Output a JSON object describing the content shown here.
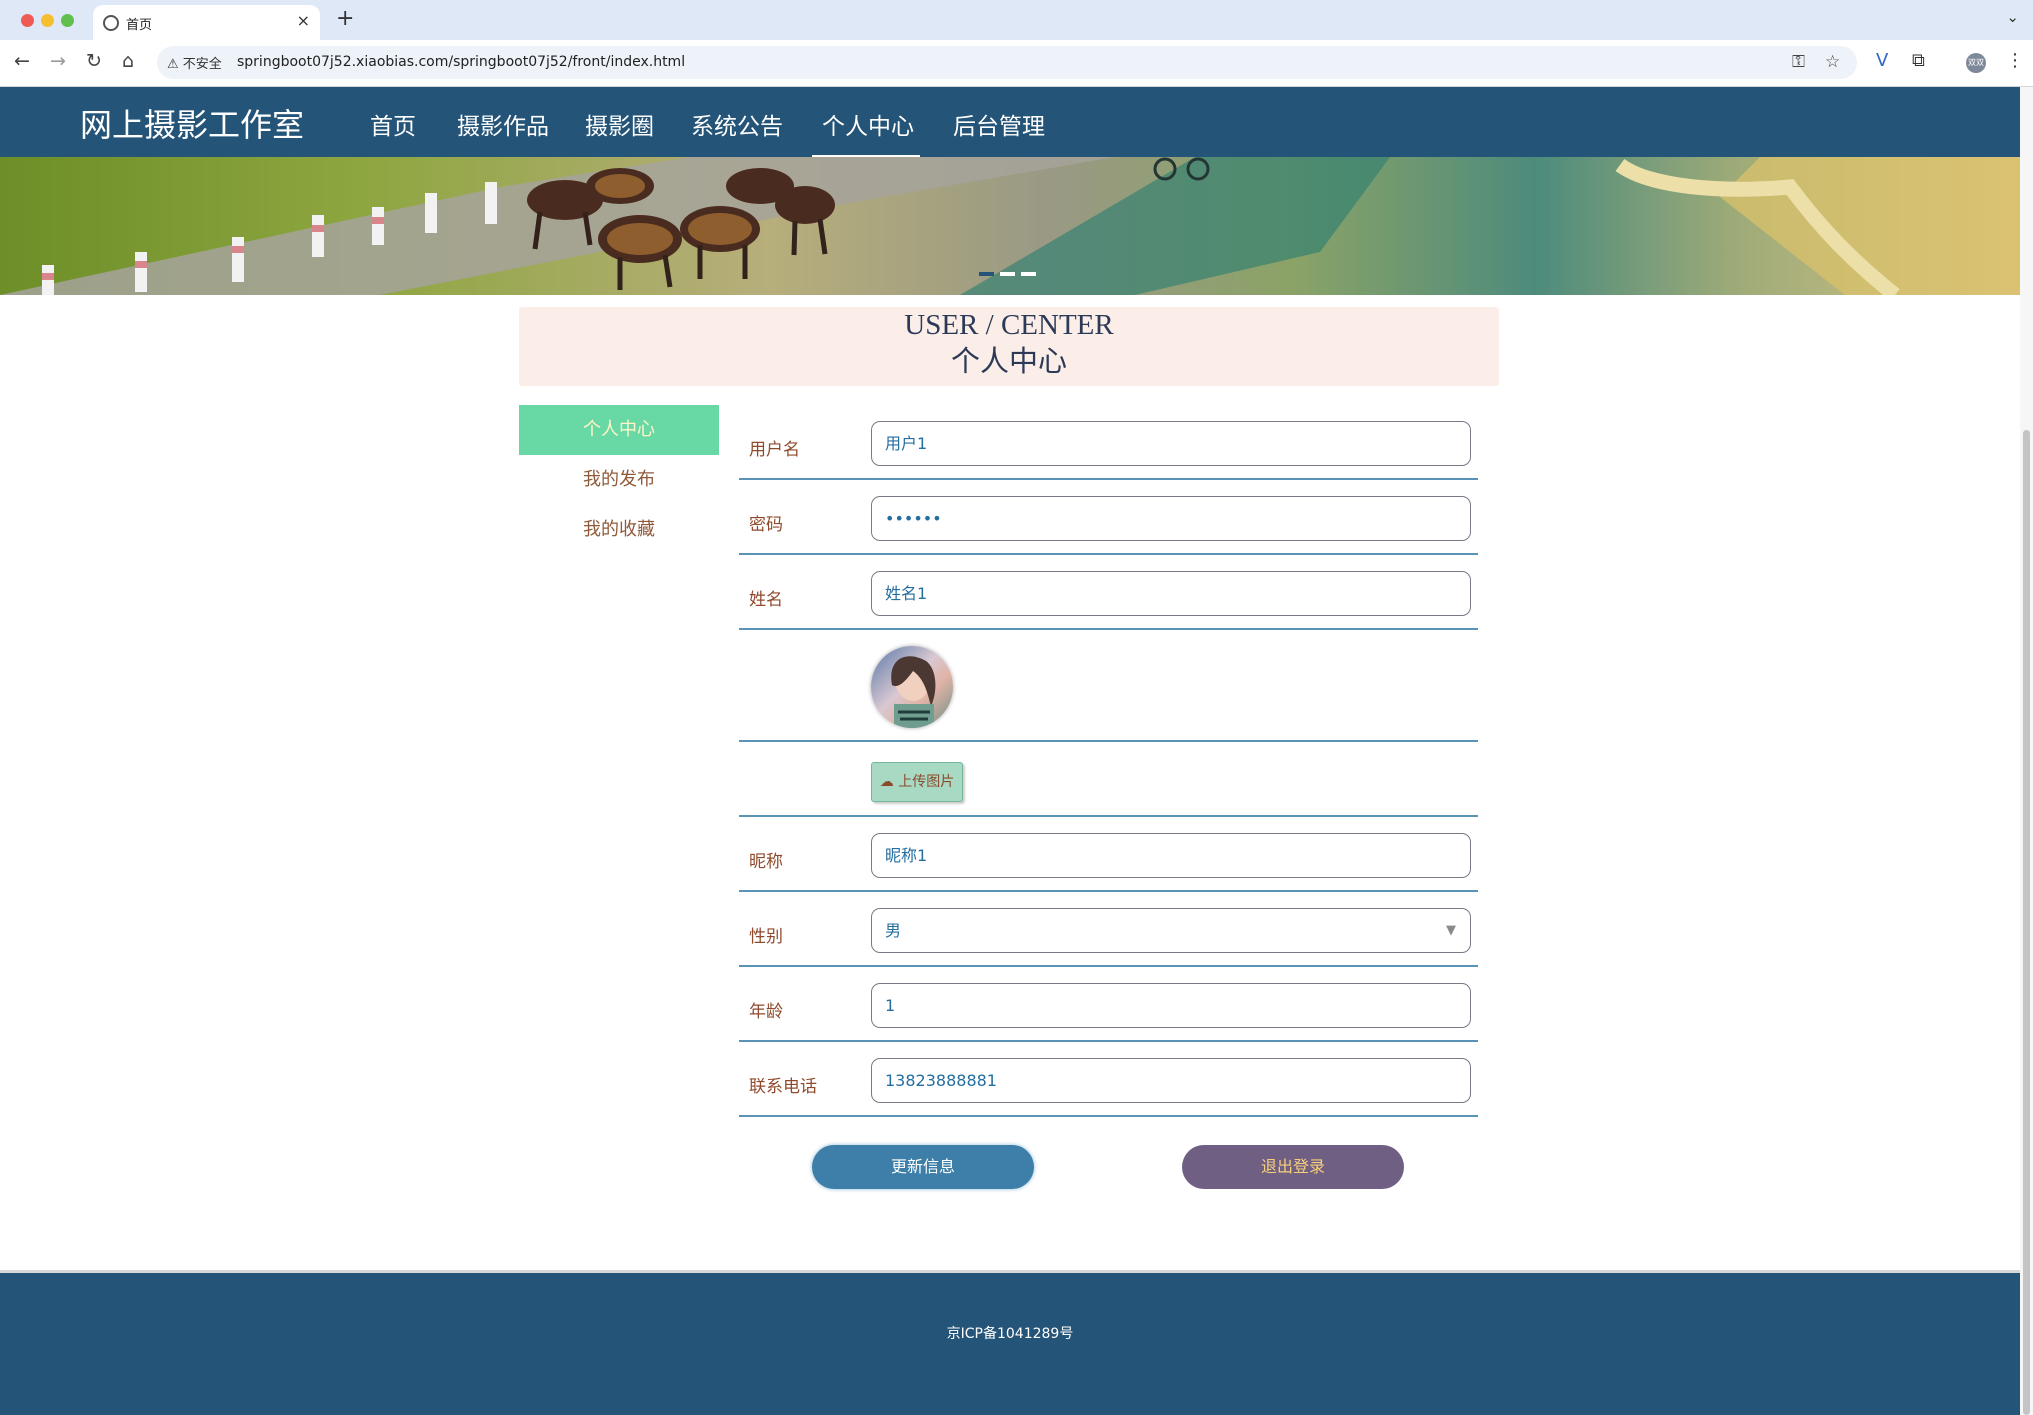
{
  "browser": {
    "tab_title": "首页",
    "url_warning": "不安全",
    "url": "springboot07j52.xiaobias.com/springboot07j52/front/index.html",
    "profile_label": "双双"
  },
  "header": {
    "site_title": "网上摄影工作室",
    "nav": [
      "首页",
      "摄影作品",
      "摄影圈",
      "系统公告",
      "个人中心",
      "后台管理"
    ],
    "active_nav": "个人中心"
  },
  "center": {
    "title_en": "USER / CENTER",
    "title_cn": "个人中心"
  },
  "sidebar": {
    "items": [
      "个人中心",
      "我的发布",
      "我的收藏"
    ],
    "active": "个人中心"
  },
  "form": {
    "username_label": "用户名",
    "username_value": "用户1",
    "password_label": "密码",
    "password_value": "••••••",
    "name_label": "姓名",
    "name_value": "姓名1",
    "upload_label": "上传图片",
    "nickname_label": "昵称",
    "nickname_value": "昵称1",
    "gender_label": "性别",
    "gender_value": "男",
    "age_label": "年龄",
    "age_value": "1",
    "phone_label": "联系电话",
    "phone_value": "13823888881"
  },
  "buttons": {
    "update": "更新信息",
    "logout": "退出登录"
  },
  "footer": {
    "icp": "京ICP备1041289号"
  },
  "icons": {
    "back": "arrow-left-icon",
    "forward": "arrow-right-icon",
    "reload": "reload-icon",
    "home": "home-icon",
    "key": "key-icon",
    "star": "star-icon",
    "upload": "cloud-upload-icon"
  },
  "colors": {
    "nav_bg": "#245478",
    "active_sidebar": "#68d9a4",
    "update_button": "#3d7fa8",
    "logout_button": "#6e5f83"
  }
}
